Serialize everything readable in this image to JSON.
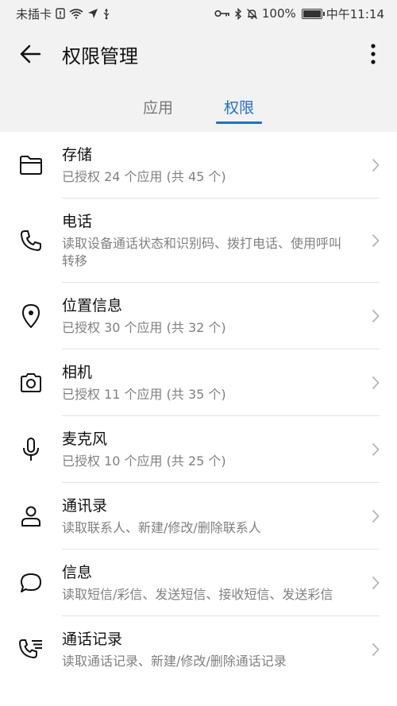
{
  "status_bar": {
    "carrier": "未插卡",
    "battery": "100%",
    "battery_level": 1.0,
    "time": "中午11:14"
  },
  "header": {
    "title": "权限管理"
  },
  "tabs": [
    {
      "label": "应用",
      "active": false
    },
    {
      "label": "权限",
      "active": true
    }
  ],
  "colors": {
    "accent": "#1f6fd1"
  },
  "permissions": [
    {
      "icon": "folder-icon",
      "title": "存储",
      "subtitle": "已授权 24 个应用 (共 45 个)"
    },
    {
      "icon": "phone-icon",
      "title": "电话",
      "subtitle": "读取设备通话状态和识别码、拨打电话、使用呼叫转移"
    },
    {
      "icon": "location-pin-icon",
      "title": "位置信息",
      "subtitle": "已授权 30 个应用 (共 32 个)"
    },
    {
      "icon": "camera-icon",
      "title": "相机",
      "subtitle": "已授权 11 个应用 (共 35 个)"
    },
    {
      "icon": "microphone-icon",
      "title": "麦克风",
      "subtitle": "已授权 10 个应用 (共 25 个)"
    },
    {
      "icon": "contact-person-icon",
      "title": "通讯录",
      "subtitle": "读取联系人、新建/修改/删除联系人"
    },
    {
      "icon": "message-bubble-icon",
      "title": "信息",
      "subtitle": "读取短信/彩信、发送短信、接收短信、发送彩信"
    },
    {
      "icon": "call-log-icon",
      "title": "通话记录",
      "subtitle": "读取通话记录、新建/修改/删除通话记录"
    }
  ]
}
